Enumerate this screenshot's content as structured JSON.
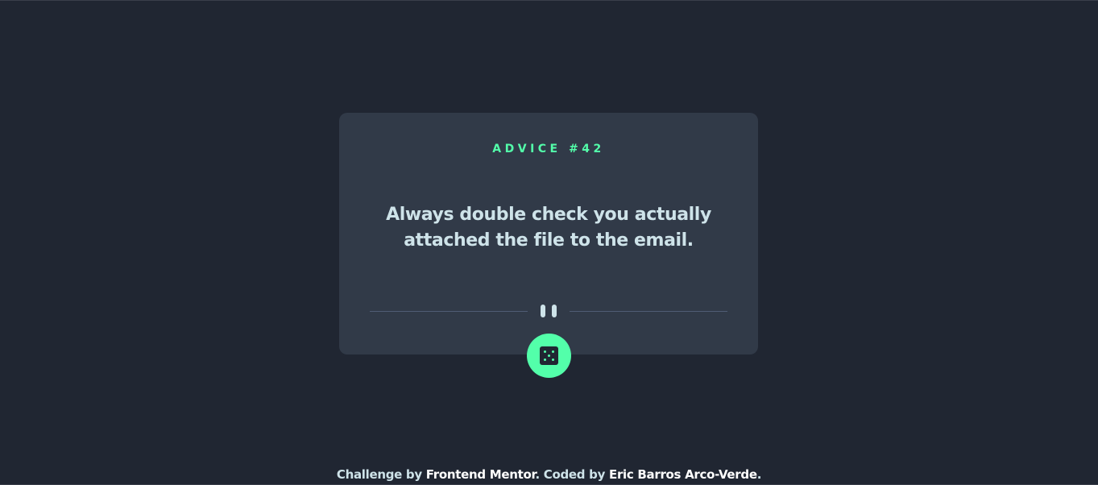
{
  "card": {
    "advice_label": "ADVICE #42",
    "advice_text": "Always double check you actually attached the file to the email."
  },
  "divider": {
    "icon": "pause-icon"
  },
  "dice_button": {
    "icon": "dice-icon",
    "aria_label": "Generate new advice"
  },
  "footer": {
    "prefix": "Challenge by ",
    "challenge_link": "Frontend Mentor",
    "middle": ". Coded by ",
    "author_link": "Eric Barros Arco-Verde",
    "suffix": "."
  },
  "colors": {
    "background": "#202632",
    "card": "#313a48",
    "accent": "#53ffaa",
    "text": "#cee3e9",
    "divider": "#4f5d74"
  }
}
